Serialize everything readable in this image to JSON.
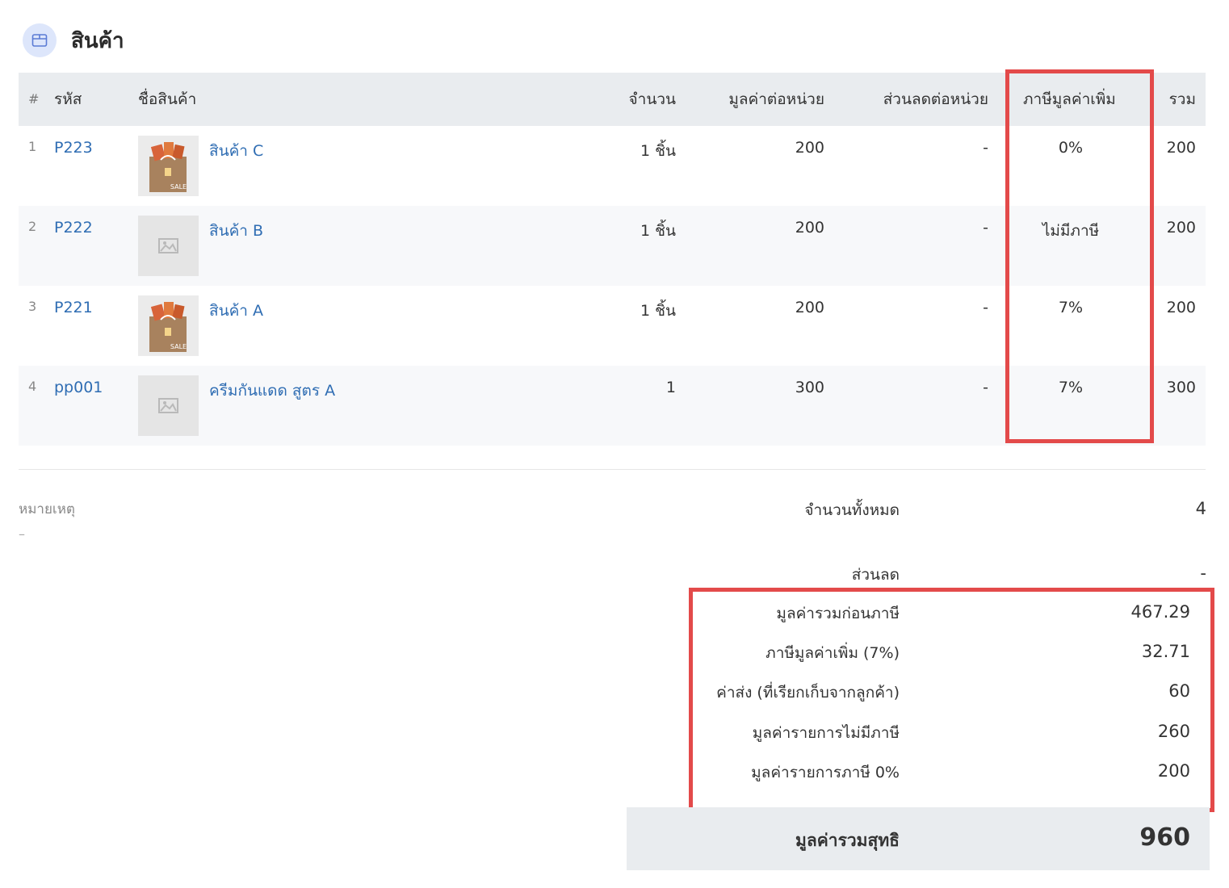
{
  "section": {
    "title": "สินค้า",
    "icon": "box-icon"
  },
  "table": {
    "headers": {
      "index": "#",
      "code": "รหัส",
      "name": "ชื่อสินค้า",
      "qty": "จำนวน",
      "unit_price": "มูลค่าต่อหน่วย",
      "unit_discount": "ส่วนลดต่อหน่วย",
      "vat": "ภาษีมูลค่าเพิ่ม",
      "total": "รวม"
    },
    "rows": [
      {
        "index": "1",
        "code": "P223",
        "name": "สินค้า C",
        "image": "shopping-bag-image",
        "qty": "1 ชิ้น",
        "unit_price": "200",
        "unit_discount": "-",
        "vat": "0%",
        "total": "200"
      },
      {
        "index": "2",
        "code": "P222",
        "name": "สินค้า B",
        "image": "placeholder-image",
        "qty": "1 ชิ้น",
        "unit_price": "200",
        "unit_discount": "-",
        "vat": "ไม่มีภาษี",
        "total": "200"
      },
      {
        "index": "3",
        "code": "P221",
        "name": "สินค้า A",
        "image": "shopping-bag-image",
        "qty": "1 ชิ้น",
        "unit_price": "200",
        "unit_discount": "-",
        "vat": "7%",
        "total": "200"
      },
      {
        "index": "4",
        "code": "pp001",
        "name": "ครีมกันแดด สูตร A",
        "image": "placeholder-image",
        "qty": "1",
        "unit_price": "300",
        "unit_discount": "-",
        "vat": "7%",
        "total": "300"
      }
    ]
  },
  "notes": {
    "label": "หมายเหตุ",
    "value": "–"
  },
  "summary": {
    "total_qty": {
      "label": "จำนวนทั้งหมด",
      "value": "4"
    },
    "discount": {
      "label": "ส่วนลด",
      "value": "-"
    },
    "pre_tax": {
      "label": "มูลค่ารวมก่อนภาษี",
      "value": "467.29"
    },
    "vat": {
      "label": "ภาษีมูลค่าเพิ่ม (7%)",
      "value": "32.71"
    },
    "shipping": {
      "label": "ค่าส่ง (ที่เรียกเก็บจากลูกค้า)",
      "value": "60"
    },
    "non_vat_items": {
      "label": "มูลค่ารายการไม่มีภาษี",
      "value": "260"
    },
    "zero_vat_items": {
      "label": "มูลค่ารายการภาษี 0%",
      "value": "200"
    },
    "net_total": {
      "label": "มูลค่ารวมสุทธิ",
      "value": "960"
    }
  },
  "colors": {
    "highlight": "#e34a4a",
    "link": "#2f6db3",
    "header_bg": "#e9ecef"
  }
}
